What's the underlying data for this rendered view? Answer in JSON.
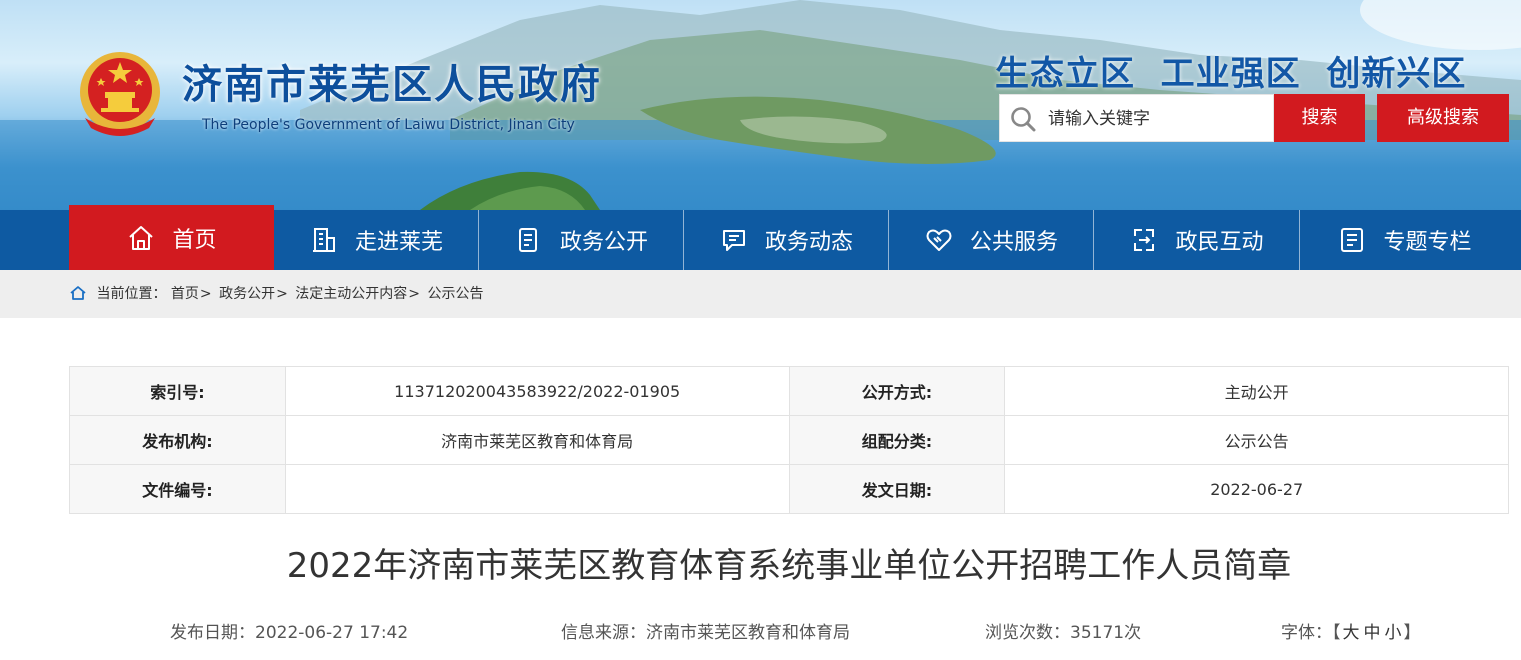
{
  "header": {
    "site_title": "济南市莱芜区人民政府",
    "site_subtitle": "The People's Government of Laiwu District, Jinan City",
    "slogan": "生态立区  工业强区  创新兴区",
    "search_placeholder": "请输入关键字",
    "search_button": "搜索",
    "advanced_search_button": "高级搜索"
  },
  "nav": {
    "items": [
      {
        "label": "首页",
        "icon": "home-icon"
      },
      {
        "label": "走进莱芜",
        "icon": "building-icon"
      },
      {
        "label": "政务公开",
        "icon": "document-icon"
      },
      {
        "label": "政务动态",
        "icon": "chat-icon"
      },
      {
        "label": "公共服务",
        "icon": "handshake-icon"
      },
      {
        "label": "政民互动",
        "icon": "interaction-icon"
      },
      {
        "label": "专题专栏",
        "icon": "list-icon"
      }
    ]
  },
  "breadcrumb": {
    "prefix": "当前位置：",
    "items": [
      "首页",
      "政务公开",
      "法定主动公开内容",
      "公示公告"
    ],
    "separator": ">"
  },
  "meta": {
    "rows": [
      {
        "k1": "索引号:",
        "v1": "11371202004358392​2/2022-01905",
        "k2": "公开方式:",
        "v2": "主动公开"
      },
      {
        "k1": "发布机构:",
        "v1": "济南市莱芜区教育和体育局",
        "k2": "组配分类:",
        "v2": "公示公告"
      },
      {
        "k1": "文件编号:",
        "v1": "",
        "k2": "发文日期:",
        "v2": "2022-06-27"
      }
    ]
  },
  "article": {
    "title": "2022年济南市莱芜区教育体育系统事业单位公开招聘工作人员简章",
    "publish_date": "发布日期：2022-06-27 17:42",
    "source": "信息来源：济南市莱芜区教育和体育局",
    "views": "浏览次数：35171次",
    "font_label": "字体：",
    "font_open": "【",
    "font_large": "大",
    "font_medium": "中",
    "font_small": "小",
    "font_close": "】"
  },
  "colors": {
    "nav_blue": "#0e5aa2",
    "accent_red": "#d21a1f",
    "title_blue": "#0d4f9c"
  }
}
